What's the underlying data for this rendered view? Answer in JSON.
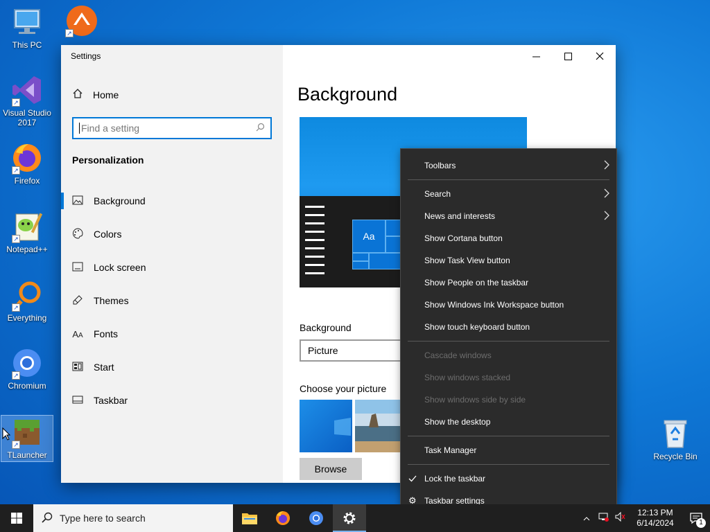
{
  "desktop": {
    "icons": [
      {
        "label": "This PC",
        "icon": "computer-icon"
      },
      {
        "label": "Visual Studio\n2017",
        "icon": "visual-studio-icon"
      },
      {
        "label": "Firefox",
        "icon": "firefox-icon"
      },
      {
        "label": "Notepad++",
        "icon": "notepad-plus-plus-icon"
      },
      {
        "label": "Everything",
        "icon": "everything-search-icon"
      },
      {
        "label": "Chromium",
        "icon": "chromium-icon"
      },
      {
        "label": "TLauncher",
        "icon": "minecraft-icon"
      },
      {
        "label": "Recycle Bin",
        "icon": "recycle-bin-icon"
      }
    ],
    "partial_icon": {
      "label": "AnyDesk",
      "icon": "anydesk-icon"
    }
  },
  "settings": {
    "title": "Settings",
    "home_label": "Home",
    "search_placeholder": "Find a setting",
    "section_title": "Personalization",
    "nav": [
      {
        "label": "Background",
        "icon": "picture-icon",
        "active": true
      },
      {
        "label": "Colors",
        "icon": "palette-icon"
      },
      {
        "label": "Lock screen",
        "icon": "lock-screen-icon"
      },
      {
        "label": "Themes",
        "icon": "brush-icon"
      },
      {
        "label": "Fonts",
        "icon": "font-icon"
      },
      {
        "label": "Start",
        "icon": "start-icon"
      },
      {
        "label": "Taskbar",
        "icon": "taskbar-icon"
      }
    ],
    "page_title": "Background",
    "preview_tile_text": "Aa",
    "background_label": "Background",
    "background_value": "Picture",
    "choose_label": "Choose your picture",
    "browse_label": "Browse"
  },
  "context_menu": {
    "groups": [
      [
        {
          "label": "Toolbars",
          "submenu": true
        }
      ],
      [
        {
          "label": "Search",
          "submenu": true
        },
        {
          "label": "News and interests",
          "submenu": true
        },
        {
          "label": "Show Cortana button"
        },
        {
          "label": "Show Task View button"
        },
        {
          "label": "Show People on the taskbar"
        },
        {
          "label": "Show Windows Ink Workspace button"
        },
        {
          "label": "Show touch keyboard button"
        }
      ],
      [
        {
          "label": "Cascade windows",
          "disabled": true
        },
        {
          "label": "Show windows stacked",
          "disabled": true
        },
        {
          "label": "Show windows side by side",
          "disabled": true
        },
        {
          "label": "Show the desktop"
        }
      ],
      [
        {
          "label": "Task Manager"
        }
      ],
      [
        {
          "label": "Lock the taskbar",
          "checked": true
        },
        {
          "label": "Taskbar settings",
          "icon": "gear-icon"
        }
      ]
    ]
  },
  "taskbar": {
    "search_placeholder": "Type here to search",
    "apps": [
      {
        "name": "File Explorer",
        "icon": "folder-icon"
      },
      {
        "name": "Firefox",
        "icon": "firefox-icon"
      },
      {
        "name": "Chromium",
        "icon": "chromium-icon"
      },
      {
        "name": "Settings",
        "icon": "gear-icon",
        "active": true
      }
    ],
    "time": "12:13 PM",
    "date": "6/14/2024",
    "notification_count": "1"
  },
  "colors": {
    "accent": "#0078d7",
    "menu_bg": "#2b2b2b",
    "taskbar_bg": "#1f1f1f",
    "desktop_bg": "#0f78d6"
  }
}
